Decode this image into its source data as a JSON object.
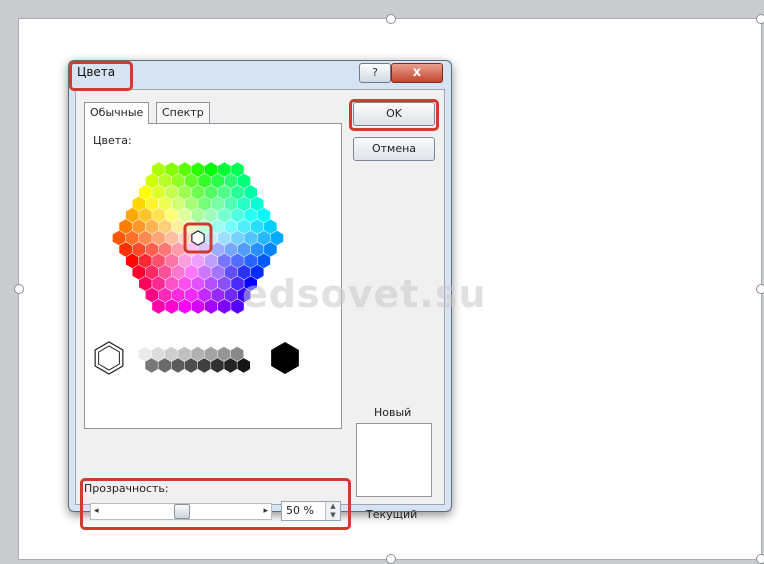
{
  "dialog": {
    "title": "Цвета",
    "help_glyph": "?",
    "close_glyph": "x"
  },
  "tabs": [
    {
      "label": "Обычные",
      "active": true
    },
    {
      "label": "Спектр",
      "active": false
    }
  ],
  "colors_label": "Цвета:",
  "buttons": {
    "ok": "OK",
    "cancel": "Отмена"
  },
  "preview": {
    "new_label": "Новый",
    "current_label": "Текущий"
  },
  "transparency": {
    "label": "Прозрачность:",
    "value": "50 %",
    "fraction": 0.5
  },
  "watermark": "edsovet.su",
  "accent_color": "#cf3b30",
  "icons": [
    "help-icon",
    "close-icon",
    "selected-hex-icon",
    "scroll-left-icon",
    "scroll-right-icon",
    "spin-up-icon",
    "spin-down-icon"
  ]
}
